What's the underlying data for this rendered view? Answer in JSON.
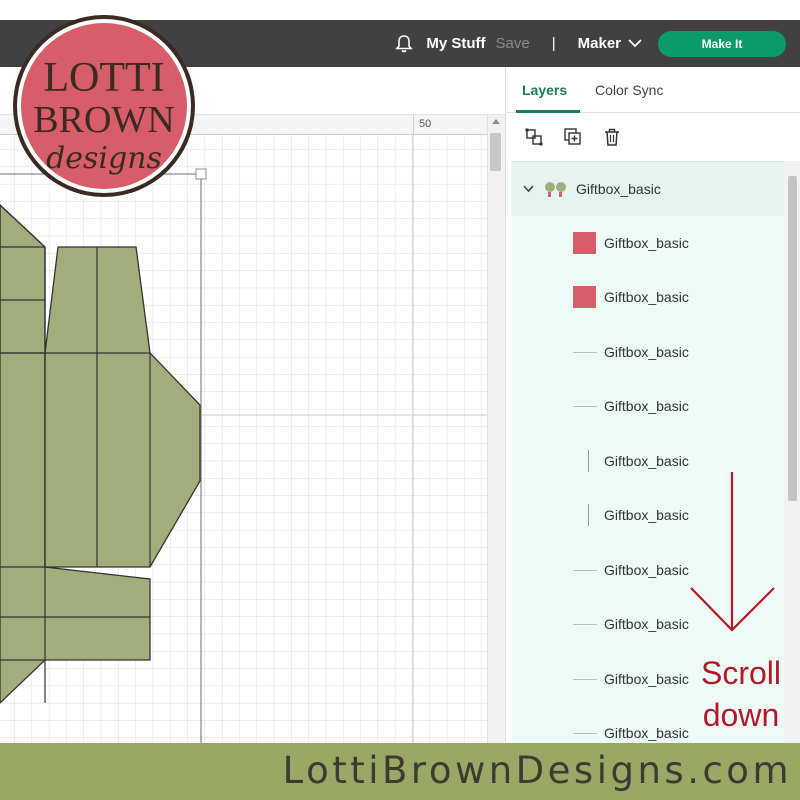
{
  "header": {
    "my_stuff": "My Stuff",
    "save": "Save",
    "separator": "|",
    "machine": "Maker",
    "make_it": "Make It",
    "accent_color": "#0c9b6b",
    "icons": [
      "bell-icon",
      "chevron-down-icon"
    ]
  },
  "canvas": {
    "ruler_label": "50",
    "shape_color": "#a1ae7c",
    "icons": [
      "resize-handle"
    ]
  },
  "panel": {
    "tabs": [
      {
        "label": "Layers",
        "active": true
      },
      {
        "label": "Color Sync",
        "active": false
      }
    ],
    "action_icons": [
      "group-icon",
      "duplicate-icon",
      "delete-icon"
    ],
    "group": {
      "name": "Giftbox_basic",
      "expanded": true
    },
    "layers": [
      {
        "name": "Giftbox_basic",
        "kind": "swatch",
        "color": "#d75d6b"
      },
      {
        "name": "Giftbox_basic",
        "kind": "swatch",
        "color": "#d75d6b"
      },
      {
        "name": "Giftbox_basic",
        "kind": "score-horizontal"
      },
      {
        "name": "Giftbox_basic",
        "kind": "score-horizontal"
      },
      {
        "name": "Giftbox_basic",
        "kind": "score-vertical"
      },
      {
        "name": "Giftbox_basic",
        "kind": "score-vertical"
      },
      {
        "name": "Giftbox_basic",
        "kind": "score-horizontal"
      },
      {
        "name": "Giftbox_basic",
        "kind": "score-horizontal"
      },
      {
        "name": "Giftbox_basic",
        "kind": "score-horizontal"
      },
      {
        "name": "Giftbox_basic",
        "kind": "score-horizontal"
      }
    ]
  },
  "annotation": {
    "line1": "Scroll",
    "line2": "down",
    "color": "#b21a2a"
  },
  "logo": {
    "line1": "LOTTI",
    "line2": "BROWN",
    "line3": "designs",
    "bg_color": "#d75d6b"
  },
  "footer": {
    "text": "LottiBrownDesigns.com",
    "bg_color": "#9aa865"
  }
}
